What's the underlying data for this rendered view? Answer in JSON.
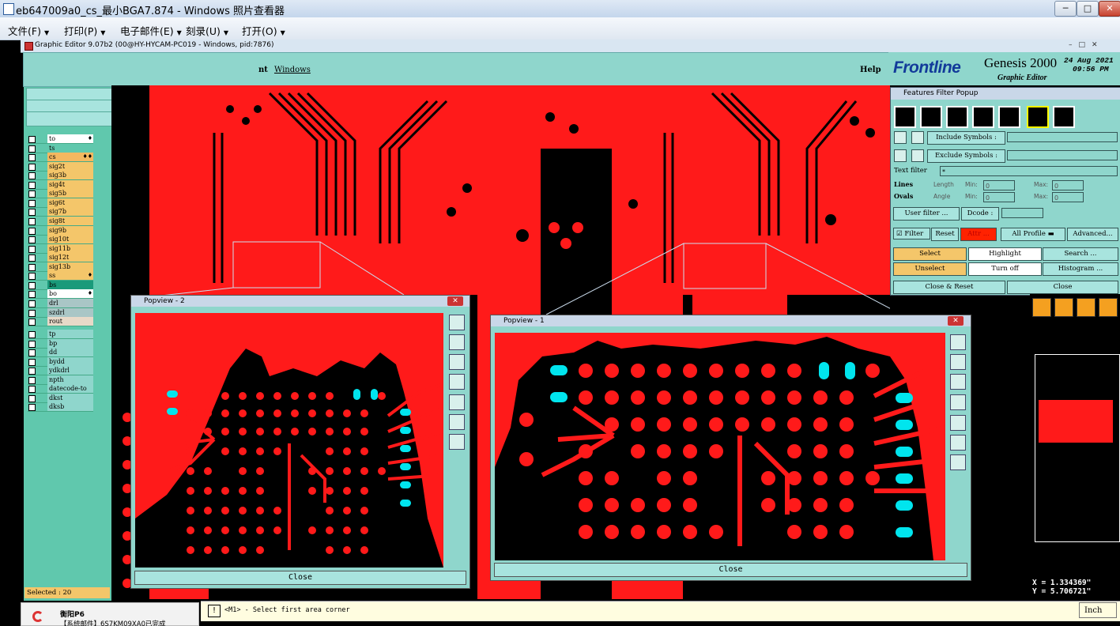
{
  "viewer": {
    "title": "eb647009a0_cs_最小BGA7.874 - Windows 照片查看器",
    "menu": [
      "文件(F)",
      "打印(P)",
      "电子邮件(E)",
      "刻录(U)",
      "打开(O)"
    ],
    "dropdown_glyph": "▼",
    "min_glyph": "─",
    "max_glyph": "□",
    "close_glyph": "✕"
  },
  "ge": {
    "title": "Graphic Editor 9.07b2 (00@HY-HYCAM-PC019 - Windows, pid:7876)",
    "menu_partial": "nt",
    "menu_windows": "Windows",
    "menu_help": "Help",
    "logo": "Frontline",
    "product": "Genesis 2000",
    "subtitle": "Graphic Editor",
    "date": "24 Aug 2021",
    "time": "09:56 PM"
  },
  "layers": {
    "group1": [
      {
        "name": "to",
        "color": "#ffffff",
        "mark": "♦"
      },
      {
        "name": "ts",
        "color": "#60c8ad",
        "mark": ""
      },
      {
        "name": "cs",
        "color": "#f4b860",
        "mark": "♦♦"
      },
      {
        "name": "sig2t",
        "color": "#f4c66a",
        "mark": ""
      },
      {
        "name": "sig3b",
        "color": "#f4c66a",
        "mark": ""
      },
      {
        "name": "sig4t",
        "color": "#f4c66a",
        "mark": ""
      },
      {
        "name": "sig5b",
        "color": "#f4c66a",
        "mark": ""
      },
      {
        "name": "sig6t",
        "color": "#f4c66a",
        "mark": ""
      },
      {
        "name": "sig7b",
        "color": "#f4c66a",
        "mark": ""
      },
      {
        "name": "sig8t",
        "color": "#f4c66a",
        "mark": ""
      },
      {
        "name": "sig9b",
        "color": "#f4c66a",
        "mark": ""
      },
      {
        "name": "sig10t",
        "color": "#f4c66a",
        "mark": ""
      },
      {
        "name": "sig11b",
        "color": "#f4c66a",
        "mark": ""
      },
      {
        "name": "sig12t",
        "color": "#f4c66a",
        "mark": ""
      },
      {
        "name": "sig13b",
        "color": "#f4c66a",
        "mark": ""
      },
      {
        "name": "ss",
        "color": "#f4c66a",
        "mark": "♦"
      },
      {
        "name": "bs",
        "color": "#1a9a7a",
        "mark": ""
      },
      {
        "name": "bo",
        "color": "#ffffff",
        "mark": "♦"
      }
    ],
    "group2": [
      {
        "name": "drl",
        "color": "#a9c6c6"
      },
      {
        "name": "szdrl",
        "color": "#a9c6c6"
      },
      {
        "name": "rout",
        "color": "#e8d9c8"
      }
    ],
    "group3": [
      {
        "name": "tp",
        "color": "#8fd6cc"
      },
      {
        "name": "bp",
        "color": "#8fd6cc"
      },
      {
        "name": "dd",
        "color": "#8fd6cc"
      },
      {
        "name": "bydd",
        "color": "#8fd6cc"
      },
      {
        "name": "ydkdrl",
        "color": "#8fd6cc"
      },
      {
        "name": "npth",
        "color": "#8fd6cc"
      },
      {
        "name": "datecode-to",
        "color": "#8fd6cc"
      },
      {
        "name": "dkst",
        "color": "#8fd6cc"
      },
      {
        "name": "dksb",
        "color": "#8fd6cc"
      }
    ],
    "selected_label": "Selected : 20"
  },
  "popview2": {
    "title": "Popview - 2",
    "close_label": "Close"
  },
  "popview1": {
    "title": "Popview - 1",
    "close_label": "Close"
  },
  "filter": {
    "title": "Features Filter Popup",
    "include_symbols": "Include Symbols :",
    "exclude_symbols": "Exclude Symbols :",
    "text_filter_label": "Text filter",
    "text_filter_value": "*",
    "lines": "Lines",
    "ovals": "Ovals",
    "length": "Length",
    "angle": "Angle",
    "min": "Min:",
    "max": "Max:",
    "min_val": "0",
    "max_val": "0",
    "user_filter": "User filter ...",
    "dcode": "Dcode :",
    "filter": "Filter",
    "reset": "Reset",
    "attr": "Attr ...",
    "all_profile": "All Profile",
    "advanced": "Advanced...",
    "select": "Select",
    "highlight": "Highlight",
    "search": "Search ...",
    "unselect": "Unselect",
    "turn_off": "Turn off",
    "histogram": "Histogram ...",
    "close_reset": "Close & Reset",
    "close": "Close"
  },
  "coords": {
    "x": "X = 1.334369\"",
    "y": "Y = 5.706721\""
  },
  "status": {
    "message": "<M1> - Select first area corner",
    "unit": "Inch",
    "icon": "!"
  },
  "taskbar": {
    "title": "衡阳P6",
    "subtitle": "【系统邮件】6S7KM09XA0已完成"
  },
  "colors": {
    "copper": "#ff1a1a",
    "board": "#000000",
    "panel": "#8fd6cc",
    "highlight": "#00e5ee"
  }
}
